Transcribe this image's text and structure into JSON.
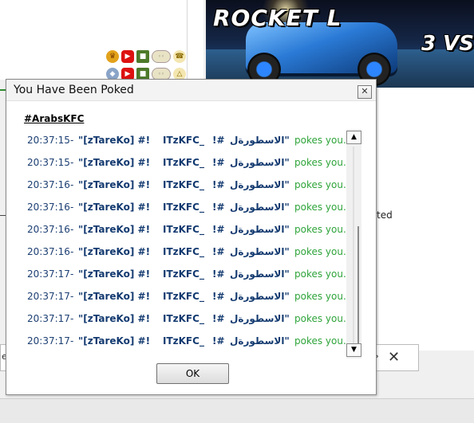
{
  "background": {
    "game_banner": {
      "title": "ROCKET L",
      "subtitle": "3 VS"
    },
    "status_text": "ted",
    "tab_close_glyph": "✕",
    "tab_arrow_glyph": "e",
    "badge_row_1": [
      "crown-icon",
      "youtube-icon",
      "cube-icon",
      "pill-badge-icon",
      "phone-icon"
    ],
    "badge_row_2": [
      "shield-icon",
      "youtube-icon",
      "cube-icon",
      "pill-badge-icon",
      "bell-icon"
    ]
  },
  "dialog": {
    "title": "You Have Been Poked",
    "close_glyph": "✕",
    "channel": "#ArabsKFC",
    "ok_label": "OK",
    "messages": [
      {
        "time": "20:37:15",
        "sep": "-",
        "nick_a": "\"[zTareKo] #!",
        "nick_b": "ITzKFC_",
        "nick_c": "!#",
        "nick_d": "الاسطورةل\"",
        "action": "pokes you."
      },
      {
        "time": "20:37:15",
        "sep": "-",
        "nick_a": "\"[zTareKo] #!",
        "nick_b": "ITzKFC_",
        "nick_c": "!#",
        "nick_d": "الاسطورةل\"",
        "action": "pokes you."
      },
      {
        "time": "20:37:16",
        "sep": "-",
        "nick_a": "\"[zTareKo] #!",
        "nick_b": "ITzKFC_",
        "nick_c": "!#",
        "nick_d": "الاسطورةل\"",
        "action": "pokes you."
      },
      {
        "time": "20:37:16",
        "sep": "-",
        "nick_a": "\"[zTareKo] #!",
        "nick_b": "ITzKFC_",
        "nick_c": "!#",
        "nick_d": "الاسطورةل\"",
        "action": "pokes you."
      },
      {
        "time": "20:37:16",
        "sep": "-",
        "nick_a": "\"[zTareKo] #!",
        "nick_b": "ITzKFC_",
        "nick_c": "!#",
        "nick_d": "الاسطورةل\"",
        "action": "pokes you."
      },
      {
        "time": "20:37:16",
        "sep": "-",
        "nick_a": "\"[zTareKo] #!",
        "nick_b": "ITzKFC_",
        "nick_c": "!#",
        "nick_d": "الاسطورةل\"",
        "action": "pokes you."
      },
      {
        "time": "20:37:17",
        "sep": "-",
        "nick_a": "\"[zTareKo] #!",
        "nick_b": "ITzKFC_",
        "nick_c": "!#",
        "nick_d": "الاسطورةل\"",
        "action": "pokes you."
      },
      {
        "time": "20:37:17",
        "sep": "-",
        "nick_a": "\"[zTareKo] #!",
        "nick_b": "ITzKFC_",
        "nick_c": "!#",
        "nick_d": "الاسطورةل\"",
        "action": "pokes you."
      },
      {
        "time": "20:37:17",
        "sep": "-",
        "nick_a": "\"[zTareKo] #!",
        "nick_b": "ITzKFC_",
        "nick_c": "!#",
        "nick_d": "الاسطورةل\"",
        "action": "pokes you."
      },
      {
        "time": "20:37:17",
        "sep": "-",
        "nick_a": "\"[zTareKo] #!",
        "nick_b": "ITzKFC_",
        "nick_c": "!#",
        "nick_d": "الاسطورةل\"",
        "action": "pokes you."
      }
    ]
  },
  "colors": {
    "nick": "#133a70",
    "timestamp": "#1d3f73",
    "action": "#2ea43a"
  }
}
